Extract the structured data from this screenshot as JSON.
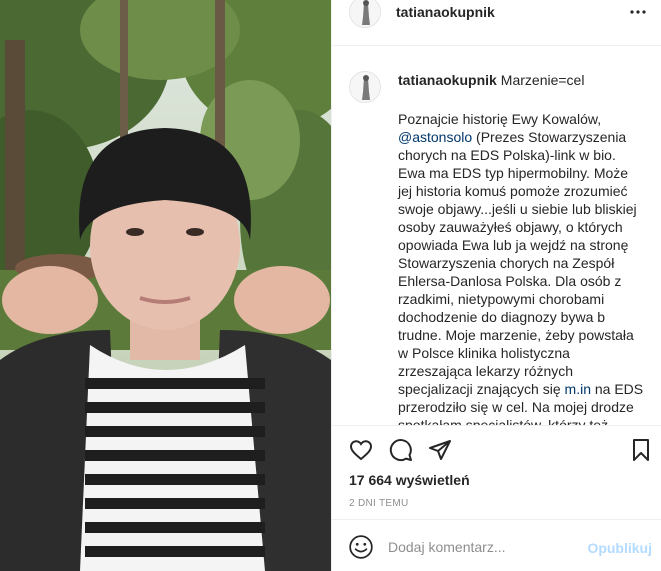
{
  "post": {
    "username": "tatianaokupnik",
    "image_alt_icon": "photo-of-woman-stretching-cheeks"
  },
  "caption": {
    "username": "tatianaokupnik",
    "title": "Marzenie=cel",
    "body_part1": "Poznajcie historię Ewy Kowalów, ",
    "mention": "@astonsolo",
    "body_part2": " (Prezes Stowarzyszenia chorych na EDS Polska)-link w bio. Ewa ma EDS typ hipermobilny. Może jej historia komuś pomoże zrozumieć swoje objawy...jeśli u siebie lub bliskiej osoby zauważyłeś objawy, o których opowiada Ewa lub ja wejdź na stronę Stowarzyszenia chorych na Zespół Ehlersa-Danlosa Polska. Dla osób z rzadkimi, nietypowymi chorobami dochodzenie do diagnozy bywa b trudne. Moje marzenie, żeby powstała w Polsce klinika holistyczna zrzeszająca lekarzy różnych specjalizacji znających się ",
    "link": "m.in",
    "body_part3": " na EDS przerodziło się w cel. Na mojej drodze spotkałam specjalistów, którzy też"
  },
  "actions": {
    "like_icon": "heart-icon",
    "comment_icon": "comment-bubble-icon",
    "share_icon": "paper-plane-icon",
    "save_icon": "bookmark-icon"
  },
  "stats": {
    "views": "17 664 wyświetleń",
    "date": "2 DNI TEMU"
  },
  "add_comment": {
    "placeholder": "Dodaj komentarz...",
    "post_label": "Opublikuj",
    "emoji_icon": "emoji-smile-icon"
  },
  "colors": {
    "text": "#262626",
    "secondary": "#8e8e8e",
    "link": "#00376b",
    "post_button_disabled": "#b3dbff",
    "border": "#efefef"
  }
}
